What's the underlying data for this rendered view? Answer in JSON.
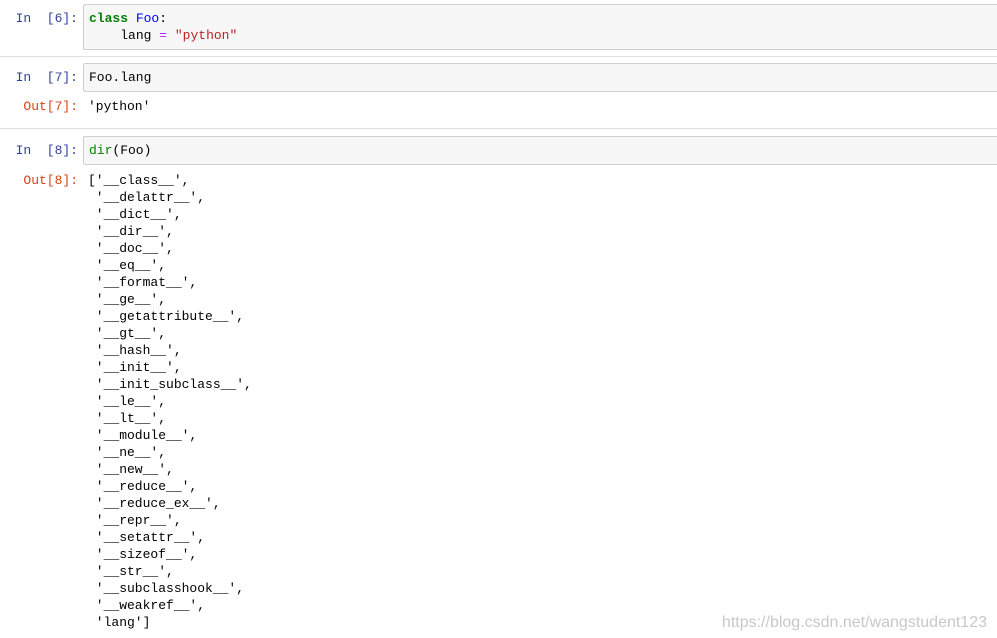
{
  "cells": [
    {
      "in_prompt": "In  [6]:",
      "code": {
        "kw_class": "class",
        "class_name": "Foo",
        "colon": ":",
        "indent": "    ",
        "attr": "lang",
        "eq": "=",
        "str_value": "\"python\""
      }
    },
    {
      "in_prompt": "In  [7]:",
      "code_text": "Foo.lang",
      "out_prompt": "Out[7]:",
      "output": "'python'"
    },
    {
      "in_prompt": "In  [8]:",
      "code_func": "dir",
      "code_args": "(Foo)",
      "out_prompt": "Out[8]:",
      "output_lines": [
        "['__class__',",
        " '__delattr__',",
        " '__dict__',",
        " '__dir__',",
        " '__doc__',",
        " '__eq__',",
        " '__format__',",
        " '__ge__',",
        " '__getattribute__',",
        " '__gt__',",
        " '__hash__',",
        " '__init__',",
        " '__init_subclass__',",
        " '__le__',",
        " '__lt__',",
        " '__module__',",
        " '__ne__',",
        " '__new__',",
        " '__reduce__',",
        " '__reduce_ex__',",
        " '__repr__',",
        " '__setattr__',",
        " '__sizeof__',",
        " '__str__',",
        " '__subclasshook__',",
        " '__weakref__',",
        " 'lang']"
      ]
    }
  ],
  "watermark": "https://blog.csdn.net/wangstudent123"
}
